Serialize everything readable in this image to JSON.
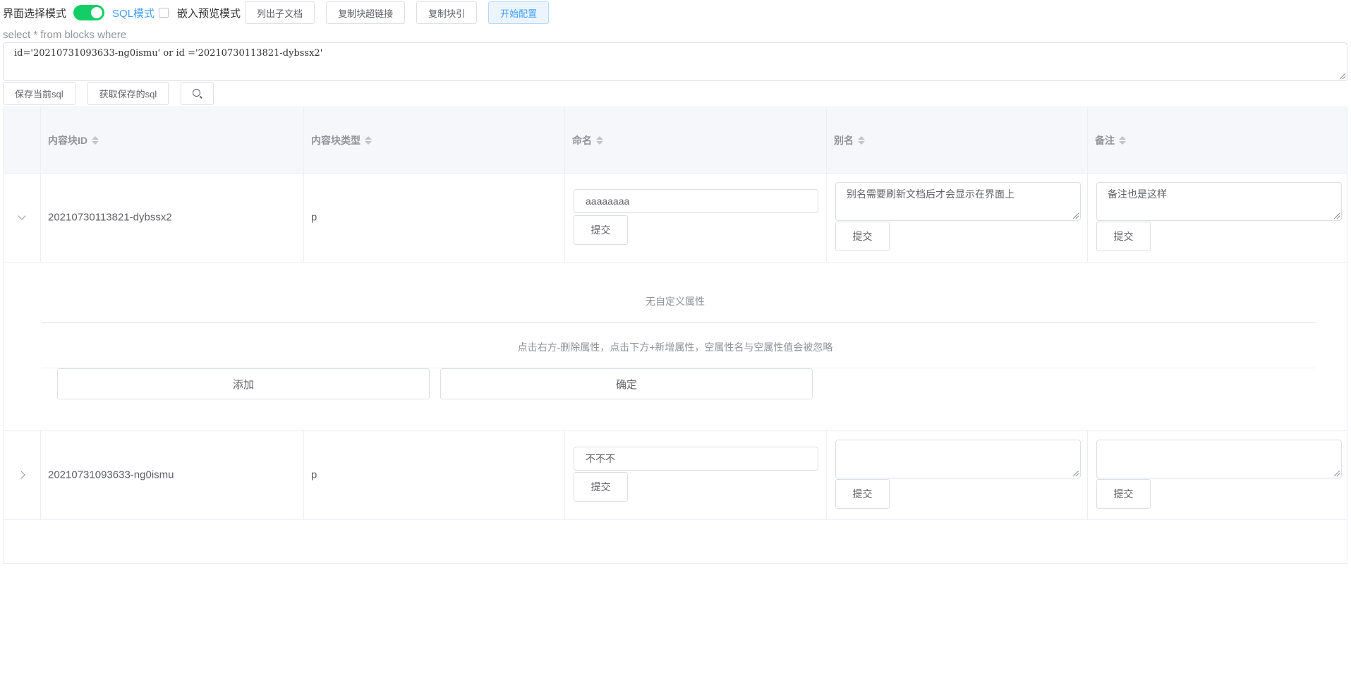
{
  "toolbar": {
    "ui_mode_label": "界面选择模式",
    "sql_mode_label": "SQL模式",
    "embed_preview_label": "嵌入预览模式",
    "buttons": {
      "list_children": "列出子文档",
      "copy_hyperlink": "复制块超链接",
      "copy_ref": "复制块引",
      "start_config": "开始配置"
    }
  },
  "sql": {
    "caption": "select * from blocks where",
    "query": "id='20210731093633-ng0ismu' or id ='20210730113821-dybssx2'",
    "save_label": "保存当前sql",
    "load_label": "获取保存的sql"
  },
  "table": {
    "headers": {
      "id": "内容块ID",
      "type": "内容块类型",
      "name": "命名",
      "alias": "别名",
      "memo": "备注"
    },
    "rows": [
      {
        "id": "20210730113821-dybssx2",
        "type": "p",
        "name": "aaaaaaaa",
        "alias": "别名需要刷新文档后才会显示在界面上",
        "memo": "备注也是这样",
        "submit": "提交",
        "expanded": true
      },
      {
        "id": "20210731093633-ng0ismu",
        "type": "p",
        "name": "不不不",
        "alias": "",
        "memo": "",
        "submit": "提交",
        "expanded": false
      }
    ],
    "expand": {
      "empty_text": "无自定义属性",
      "hint": "点击右方-删除属性，点击下方+新增属性，空属性名与空属性值会被忽略",
      "add_label": "添加",
      "confirm_label": "确定"
    }
  },
  "colors": {
    "switch_on": "#13ce66",
    "accent": "#409eff"
  }
}
